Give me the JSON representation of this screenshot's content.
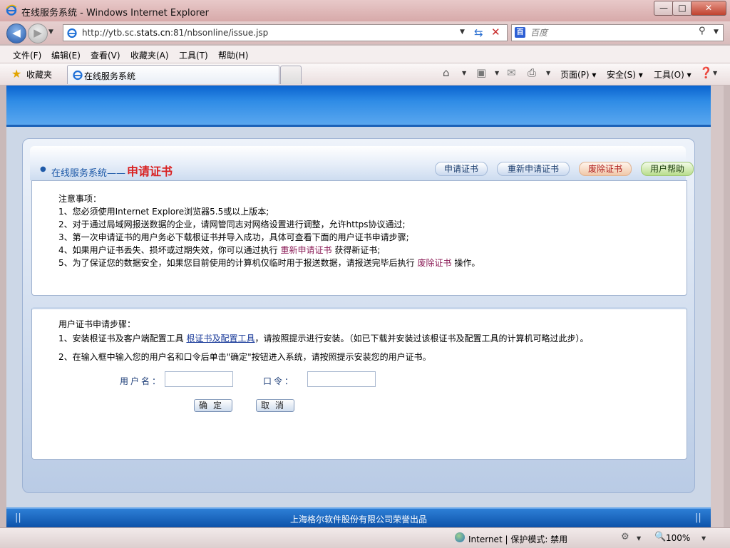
{
  "window": {
    "title": "在线服务系统 - Windows Internet Explorer",
    "min_label": "—",
    "max_label": "□",
    "close_label": "✕"
  },
  "address": {
    "url_prefix": "http://ytb.sc.",
    "url_domain": "stats.cn",
    "url_suffix": ":81/nbsonline/issue.jsp",
    "search_placeholder": "百度"
  },
  "menu": [
    "文件(F)",
    "编辑(E)",
    "查看(V)",
    "收藏夹(A)",
    "工具(T)",
    "帮助(H)"
  ],
  "favorites": {
    "label": "收藏夹",
    "tab_label": "在线服务系统"
  },
  "commandbar": {
    "page": "页面(P)",
    "safety": "安全(S)",
    "tools": "工具(O)"
  },
  "page": {
    "system_label": "在线服务系统——",
    "title": "申请证书",
    "nav": {
      "apply": "申请证书",
      "reapply": "重新申请证书",
      "revoke": "废除证书",
      "help": "用户帮助"
    },
    "notice": {
      "heading": "注意事项：",
      "line1": "1、您必须使用Internet Explore浏览器5.5或以上版本;",
      "line2": "2、对于通过局域网报送数据的企业，请网管同志对网络设置进行调整，允许https协议通过;",
      "line3": "3、第一次申请证书的用户务必下载根证书并导入成功，具体可查看下面的用户证书申请步骤;",
      "line4_pre": "4、如果用户证书丢失、损坏或过期失效，你可以通过执行",
      "line4_link": "重新申请证书",
      "line4_post": "获得新证书;",
      "line5_pre": "5、为了保证您的数据安全，如果您目前使用的计算机仅临时用于报送数据，请报送完毕后执行",
      "line5_link": "废除证书",
      "line5_post": "操作。"
    },
    "steps": {
      "heading": "用户证书申请步骤：",
      "step1_pre": "1、安装根证书及客户端配置工具",
      "step1_link": "根证书及配置工具",
      "step1_post": "，请按照提示进行安装。（如已下载并安装过该根证书及配置工具的计算机可略过此步）。",
      "step2": "2、在输入框中输入您的用户名和口令后单击\"确定\"按钮进入系统，请按照提示安装您的用户证书。",
      "username_label": "用户名：",
      "password_label": "口令：",
      "username_value": "",
      "password_value": "",
      "ok_label": "确定",
      "cancel_label": "取消"
    },
    "footer": "上海格尔软件股份有限公司荣誉出品"
  },
  "status": {
    "zone": "Internet | 保护模式: 禁用",
    "zoom": "100%"
  }
}
